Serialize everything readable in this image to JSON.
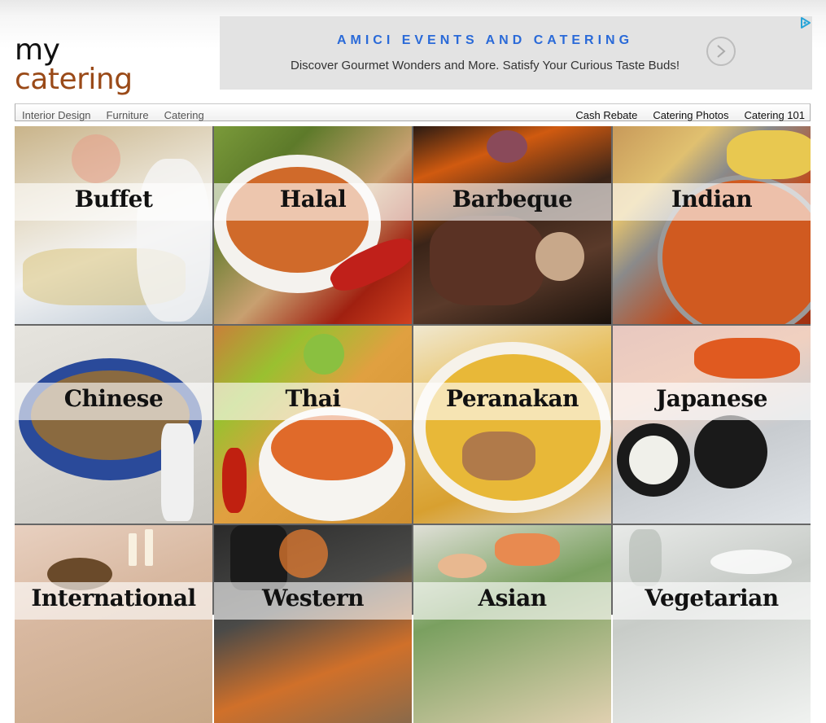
{
  "logo": {
    "line1": "my",
    "line2": "catering"
  },
  "ad": {
    "title": "AMICI EVENTS AND CATERING",
    "description": "Discover Gourmet Wonders and More. Satisfy Your Curious Taste Buds!",
    "arrow_icon": "chevron-right-icon",
    "adchoices_icon": "play-triangle-icon"
  },
  "nav": {
    "left": [
      "Interior Design",
      "Furniture",
      "Catering"
    ],
    "right": [
      "Cash Rebate",
      "Catering Photos",
      "Catering 101"
    ]
  },
  "tiles": [
    {
      "label": "Buffet"
    },
    {
      "label": "Halal"
    },
    {
      "label": "Barbeque"
    },
    {
      "label": "Indian"
    },
    {
      "label": "Chinese"
    },
    {
      "label": "Thai"
    },
    {
      "label": "Peranakan"
    },
    {
      "label": "Japanese"
    },
    {
      "label": "International"
    },
    {
      "label": "Western"
    },
    {
      "label": "Asian"
    },
    {
      "label": "Vegetarian"
    }
  ],
  "colors": {
    "logo_accent": "#9a4a18",
    "ad_title": "#2a6ad8",
    "ad_background": "#e3e3e3"
  }
}
